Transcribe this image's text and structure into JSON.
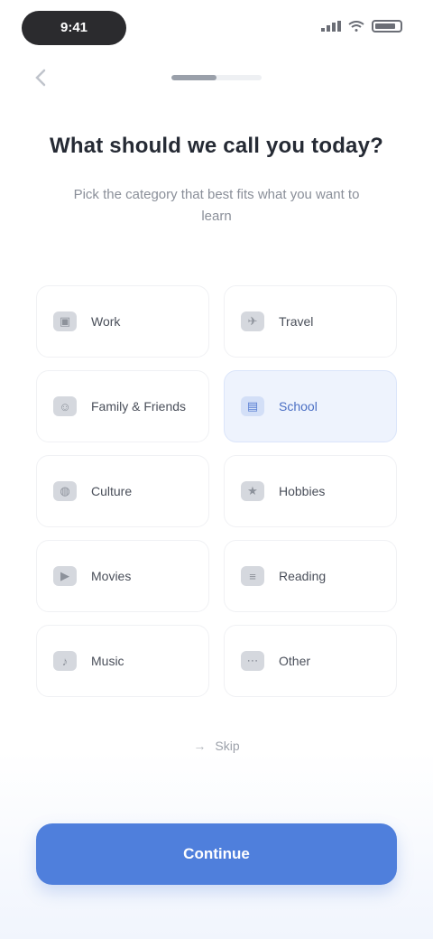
{
  "status_bar": {
    "time": "9:41"
  },
  "nav": {
    "back_icon": "chevron-left-icon",
    "progress": 0.5,
    "progress_label": ""
  },
  "header": {
    "title": "What should we call you today?",
    "subtitle": "Pick the category that best fits what you want to learn"
  },
  "options": [
    {
      "label": "Work",
      "icon": "briefcase-icon",
      "selected": false
    },
    {
      "label": "Travel",
      "icon": "plane-icon",
      "selected": false
    },
    {
      "label": "Family & Friends",
      "icon": "users-icon",
      "selected": false
    },
    {
      "label": "School",
      "icon": "book-icon",
      "selected": true
    },
    {
      "label": "Culture",
      "icon": "globe-icon",
      "selected": false
    },
    {
      "label": "Hobbies",
      "icon": "star-icon",
      "selected": false
    },
    {
      "label": "Movies",
      "icon": "film-icon",
      "selected": false
    },
    {
      "label": "Reading",
      "icon": "document-icon",
      "selected": false
    },
    {
      "label": "Music",
      "icon": "music-icon",
      "selected": false
    },
    {
      "label": "Other",
      "icon": "dots-icon",
      "selected": false
    }
  ],
  "more": {
    "label": "Skip",
    "icon": "arrow-icon"
  },
  "continue_label": "Continue",
  "colors": {
    "accent": "#4f7fdc",
    "selected_bg": "#eef3fd"
  }
}
